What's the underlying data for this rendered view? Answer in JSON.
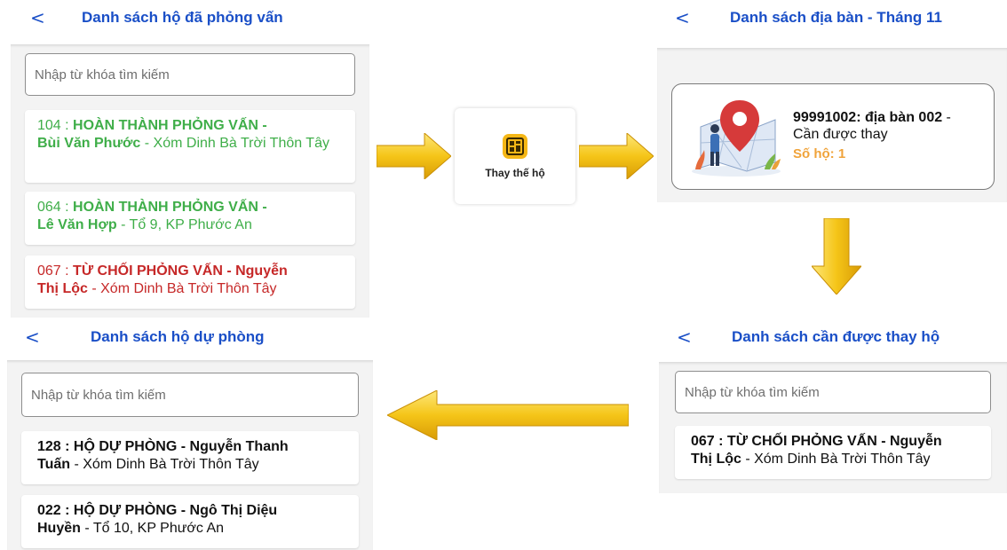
{
  "panel_interviewed": {
    "back": "<",
    "title": "Danh sách hộ đã phỏng vấn",
    "search_placeholder": "Nhập từ khóa tìm kiếm",
    "items": [
      {
        "code": "104 :",
        "status": "HOÀN THÀNH PHỎNG VẤN -",
        "name": "Bùi Văn Phước",
        "address": "- Xóm Dinh Bà Trời Thôn Tây"
      },
      {
        "code": "064 :",
        "status": "HOÀN THÀNH PHỎNG VẤN -",
        "name": "Lê Văn Hợp",
        "address": "- Tổ 9, KP Phước An"
      },
      {
        "code": "067 :",
        "status": "TỪ CHỐI PHỎNG VẤN - Nguyễn",
        "name": "Thị Lộc",
        "address": "- Xóm Dinh Bà Trời Thôn Tây"
      }
    ]
  },
  "action": {
    "label": "Thay thế hộ",
    "icon": "replace-household-icon"
  },
  "panel_areas": {
    "back": "<",
    "title": "Danh sách địa bàn - Tháng 11",
    "card": {
      "code": "99991002: địa bàn 002",
      "dash": " -",
      "note": "Cần được thay",
      "count": "Số hộ: 1"
    }
  },
  "panel_needs_replace": {
    "back": "<",
    "title": "Danh sách cần được thay hộ",
    "search_placeholder": "Nhập từ khóa tìm kiếm",
    "items": [
      {
        "code": "067 : TỪ CHỐI PHỎNG VẤN - Nguyễn",
        "name": "Thị Lộc",
        "address": " - Xóm Dinh Bà Trời Thôn Tây"
      }
    ]
  },
  "panel_reserve": {
    "back": "<",
    "title": "Danh sách hộ dự phòng",
    "search_placeholder": "Nhập từ khóa tìm kiếm",
    "items": [
      {
        "code": "128 : HỘ DỰ PHÒNG - Nguyễn Thanh",
        "name": "Tuấn",
        "address": " - Xóm Dinh Bà Trời Thôn Tây"
      },
      {
        "code": "022 : HỘ DỰ PHÒNG - Ngô Thị Diệu",
        "name": "Huyền",
        "address": " - Tổ 10, KP Phước An"
      }
    ]
  },
  "colors": {
    "title_blue": "#1a4fc7",
    "done_green": "#3fae49",
    "refused_red": "#c62828",
    "count_orange": "#f0a33a",
    "arrow_yellow": "#f5c518"
  }
}
